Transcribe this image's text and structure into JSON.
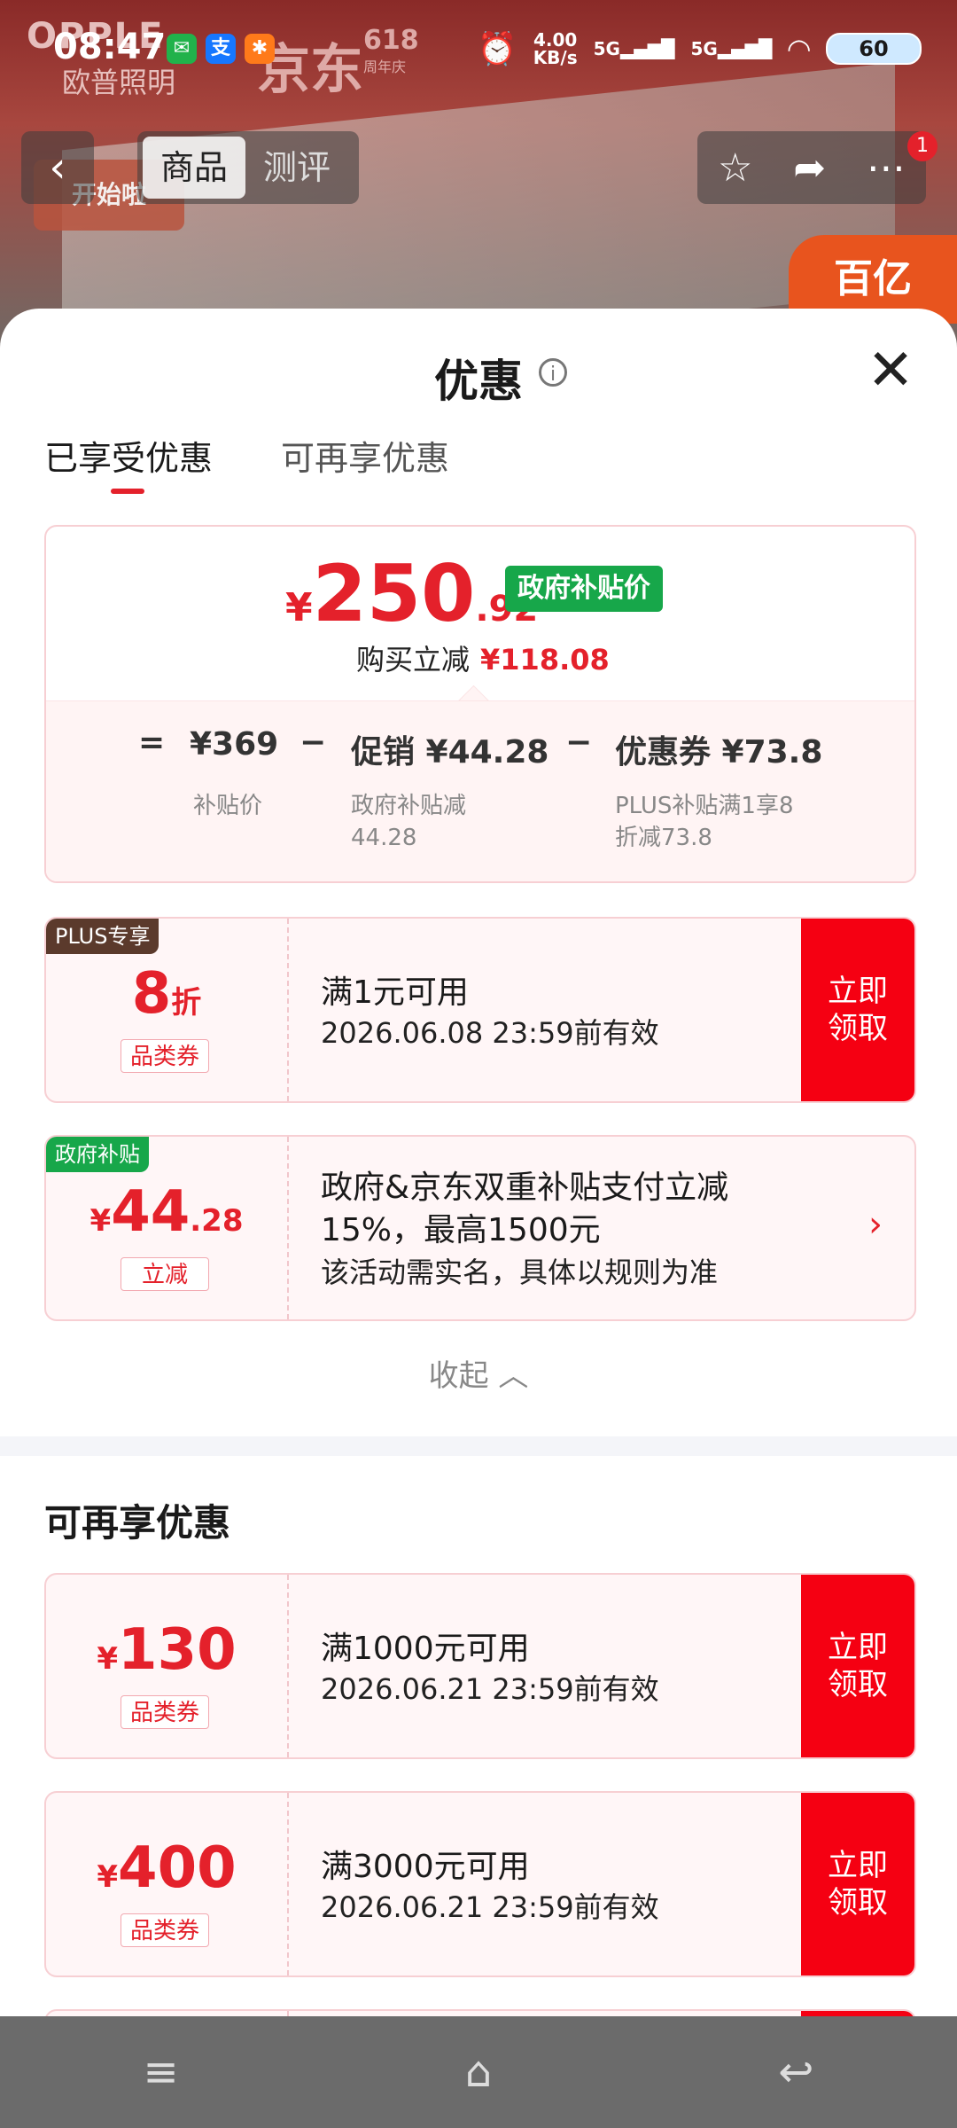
{
  "status_bar": {
    "time": "08:47",
    "net_speed_top": "4.00",
    "net_speed_unit": "KB/s",
    "sig1": "5G",
    "sig2": "5G",
    "battery": "60"
  },
  "background": {
    "brand_top": "OPPLE",
    "brand_sub": "欧普照明",
    "jd": "京东",
    "jd_618": "618",
    "jd_618_sub": "周年庆",
    "start_badge": "开始啦",
    "corner_badge": "百亿"
  },
  "topnav": {
    "tabs": [
      "商品",
      "测评"
    ],
    "badge": "1"
  },
  "sheet": {
    "title": "优惠",
    "tabs": [
      "已享受优惠",
      "可再享优惠"
    ],
    "price": {
      "currency": "¥",
      "int": "250",
      "dec": ".92",
      "tag": "政府补贴价",
      "reduce_label": "购买立减",
      "reduce_amount": "¥118.08"
    },
    "formula": {
      "eq": "=",
      "base": "¥369",
      "base_label": "补贴价",
      "minus1": "−",
      "promo": "促销 ¥44.28",
      "promo_label1": "政府补贴减",
      "promo_label2": "44.28",
      "minus2": "−",
      "coupon": "优惠券 ¥73.8",
      "coupon_label1": "PLUS补贴满1享8",
      "coupon_label2": "折减73.8"
    },
    "coupons_enjoyed": [
      {
        "corner": "PLUS专享",
        "value": "8",
        "unit": "折",
        "kind": "品类券",
        "cond": "满1元可用",
        "valid": "2026.06.08 23:59前有效",
        "claim": "立即\n领取"
      },
      {
        "corner": "政府补贴",
        "cur": "¥",
        "int": "44",
        "dec": ".28",
        "kind": "立减",
        "line1": "政府&京东双重补贴支付立减",
        "line2": "15%，最高1500元",
        "line3": "该活动需实名，具体以规则为准"
      }
    ],
    "collapse": "收起",
    "more_title": "可再享优惠",
    "coupons_more": [
      {
        "cur": "¥",
        "value": "130",
        "kind": "品类券",
        "cond": "满1000元可用",
        "valid": "2026.06.21 23:59前有效",
        "claim": "立即\n领取"
      },
      {
        "cur": "¥",
        "value": "400",
        "kind": "品类券",
        "cond": "满3000元可用",
        "valid": "2026.06.21 23:59前有效",
        "claim": "立即\n领取"
      }
    ]
  },
  "colors": {
    "accent_red": "#e4212b",
    "claim_red": "#f50012",
    "gov_green": "#17a74a",
    "plus_brown": "#5b3a2c"
  }
}
